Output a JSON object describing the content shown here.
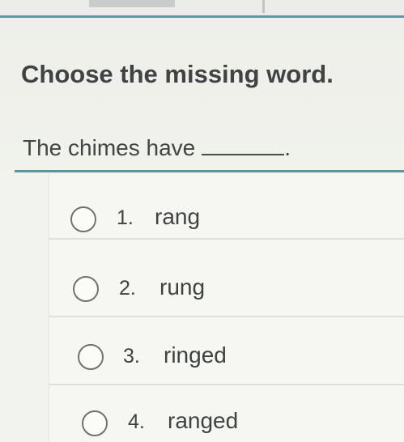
{
  "question": {
    "prompt": "Choose the missing word.",
    "sentence_before": "The chimes have",
    "sentence_after": "."
  },
  "options": [
    {
      "number": "1.",
      "text": "rang",
      "selected": false
    },
    {
      "number": "2.",
      "text": "rung",
      "selected": false
    },
    {
      "number": "3.",
      "text": "ringed",
      "selected": false
    },
    {
      "number": "4.",
      "text": "ranged",
      "selected": false
    }
  ],
  "colors": {
    "accent_rule": "#5a95a0",
    "background": "#f2f3ee",
    "text": "#3a3d3c"
  }
}
